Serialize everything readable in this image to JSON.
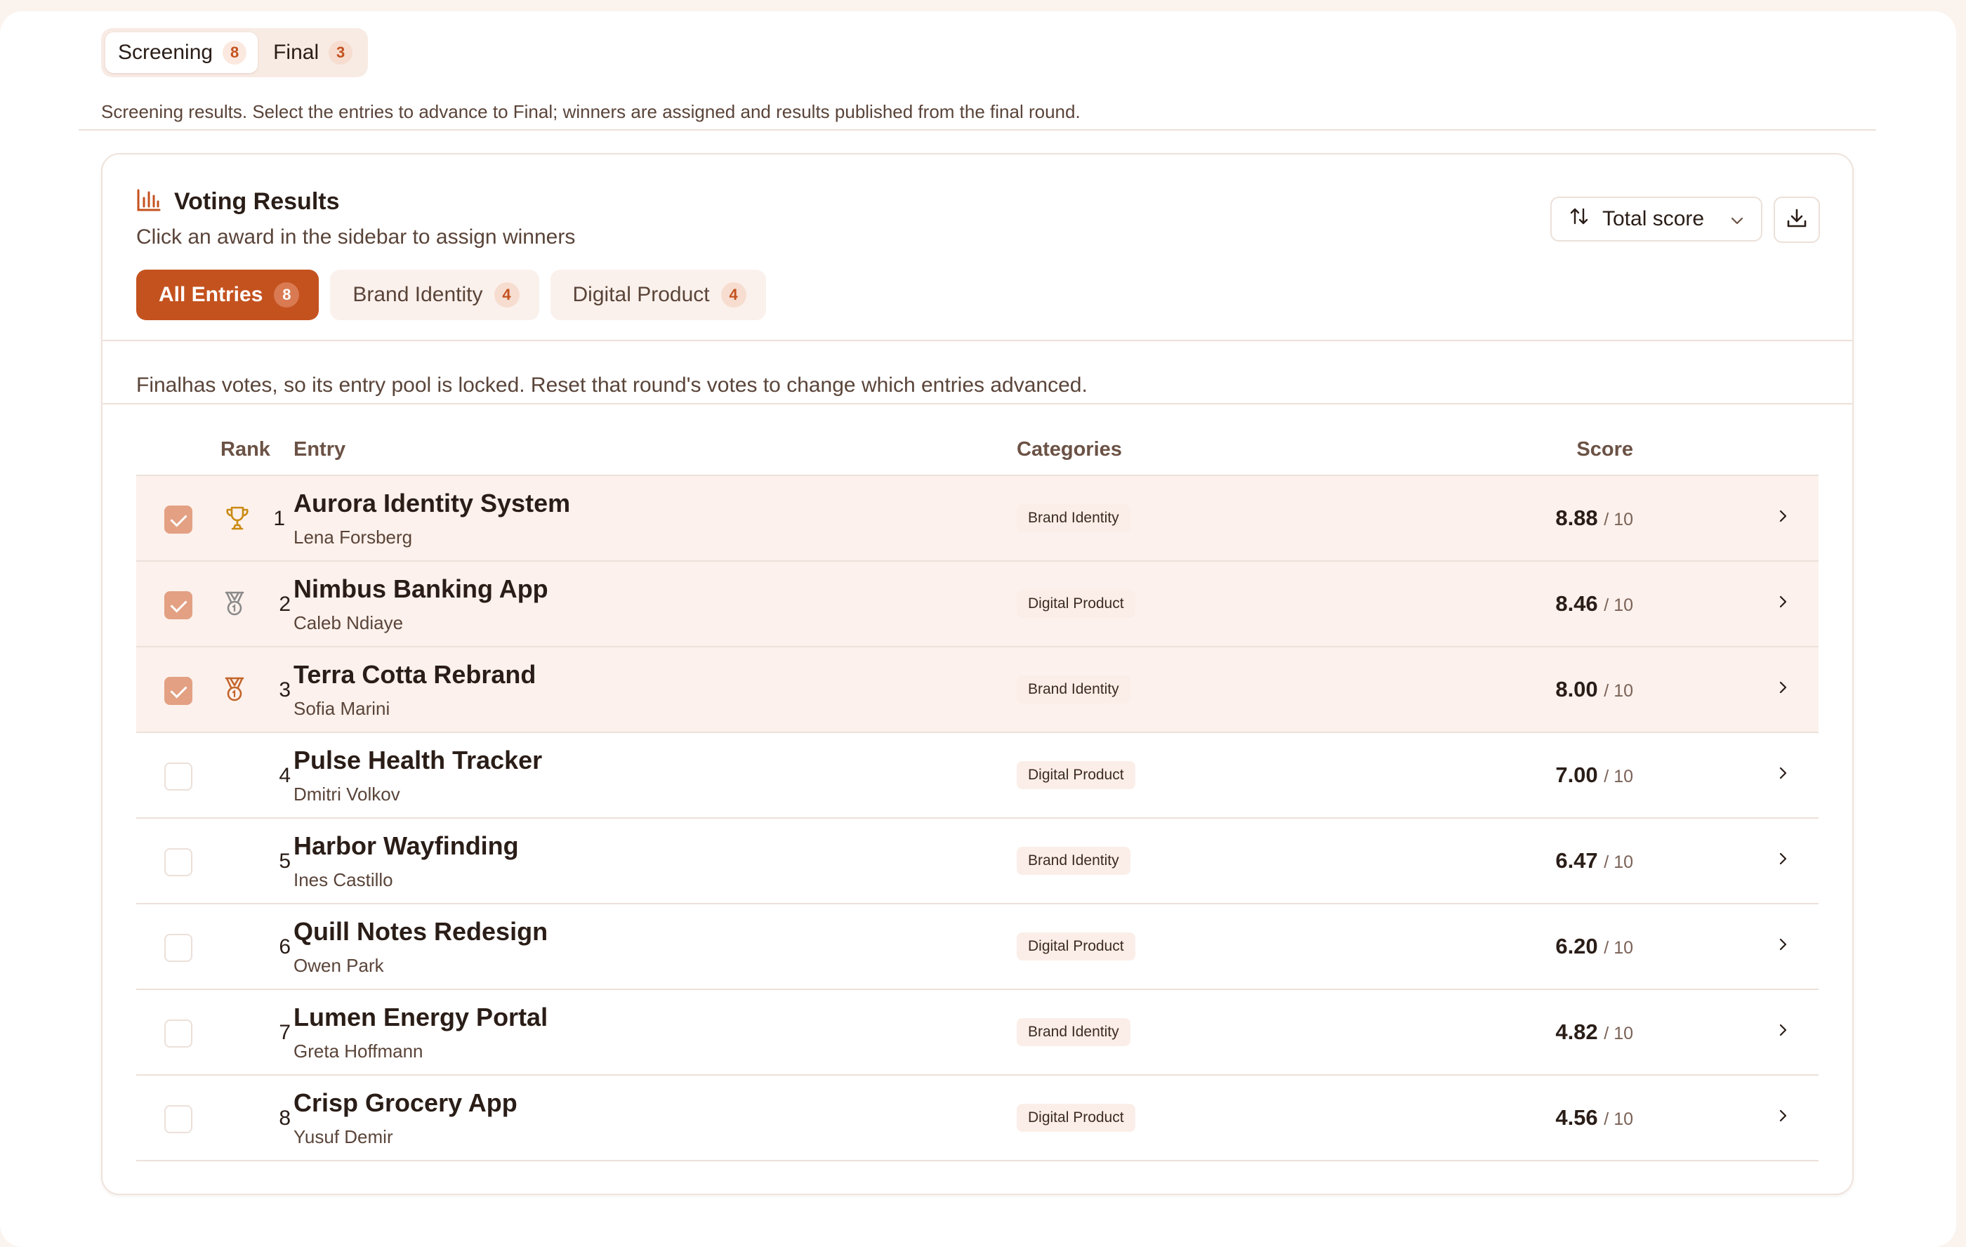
{
  "rounds": [
    {
      "label": "Screening",
      "count": "8",
      "active": true
    },
    {
      "label": "Final",
      "count": "3",
      "active": false
    }
  ],
  "round_description": "Screening results. Select the entries to advance to Final; winners are assigned and results published from the final round.",
  "card": {
    "title": "Voting Results",
    "subtitle": "Click an award in the sidebar to assign winners",
    "sort_label": "Total score",
    "title_icon": "bar-chart-icon",
    "download_icon": "download-icon"
  },
  "category_tabs": [
    {
      "label": "All Entries",
      "count": "8",
      "active": true
    },
    {
      "label": "Brand Identity",
      "count": "4",
      "active": false
    },
    {
      "label": "Digital Product",
      "count": "4",
      "active": false
    }
  ],
  "lock_notice": "Finalhas votes, so its entry pool is locked. Reset that round's votes to change which entries advanced.",
  "table": {
    "headers": {
      "rank": "Rank",
      "entry": "Entry",
      "categories": "Categories",
      "score": "Score"
    },
    "score_denominator": "/ 10",
    "rows": [
      {
        "rank": "1",
        "title": "Aurora Identity System",
        "author": "Lena Forsberg",
        "category": "Brand Identity",
        "score": "8.88",
        "selected": true,
        "medal": "trophy-icon"
      },
      {
        "rank": "2",
        "title": "Nimbus Banking App",
        "author": "Caleb Ndiaye",
        "category": "Digital Product",
        "score": "8.46",
        "selected": true,
        "medal": "silver-medal-icon"
      },
      {
        "rank": "3",
        "title": "Terra Cotta Rebrand",
        "author": "Sofia Marini",
        "category": "Brand Identity",
        "score": "8.00",
        "selected": true,
        "medal": "bronze-medal-icon"
      },
      {
        "rank": "4",
        "title": "Pulse Health Tracker",
        "author": "Dmitri Volkov",
        "category": "Digital Product",
        "score": "7.00",
        "selected": false,
        "medal": ""
      },
      {
        "rank": "5",
        "title": "Harbor Wayfinding",
        "author": "Ines Castillo",
        "category": "Brand Identity",
        "score": "6.47",
        "selected": false,
        "medal": ""
      },
      {
        "rank": "6",
        "title": "Quill Notes Redesign",
        "author": "Owen Park",
        "category": "Digital Product",
        "score": "6.20",
        "selected": false,
        "medal": ""
      },
      {
        "rank": "7",
        "title": "Lumen Energy Portal",
        "author": "Greta Hoffmann",
        "category": "Brand Identity",
        "score": "4.82",
        "selected": false,
        "medal": ""
      },
      {
        "rank": "8",
        "title": "Crisp Grocery App",
        "author": "Yusuf Demir",
        "category": "Digital Product",
        "score": "4.56",
        "selected": false,
        "medal": ""
      }
    ]
  },
  "colors": {
    "accent": "#c4521f",
    "selected_row": "#fcf1ec",
    "checkbox_on": "#e3a083",
    "gold": "#c98a12",
    "silver": "#8a8a8a",
    "bronze": "#c4642a"
  }
}
